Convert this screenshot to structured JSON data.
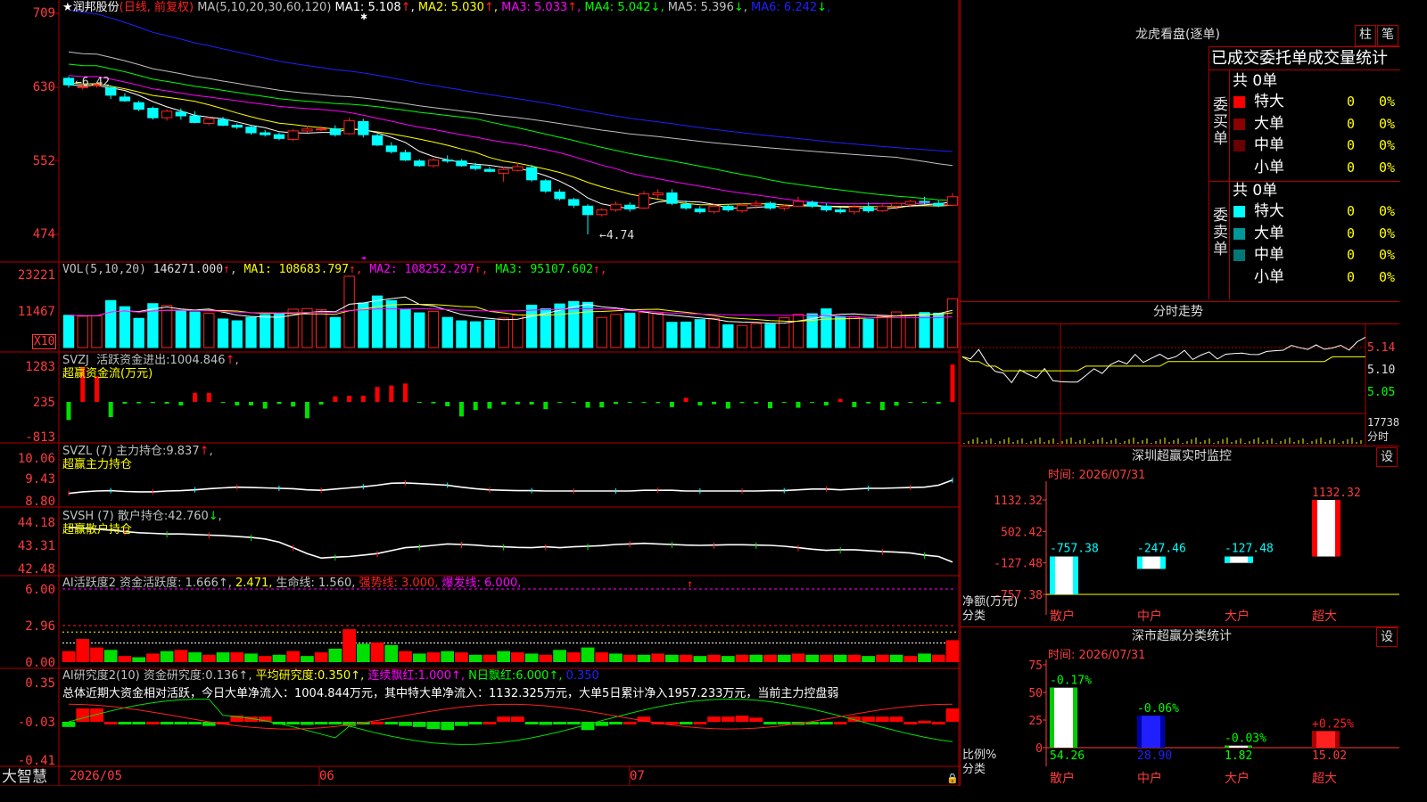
{
  "colors": {
    "up": "#ff2020",
    "down": "#00ffff",
    "ma1": "#ffffff",
    "ma2": "#ffff00",
    "ma3": "#ff00ff",
    "ma4": "#00ff00",
    "ma5": "#c0c0c0",
    "ma6": "#2020ff",
    "grid": "#b00000",
    "axis": "#ff3c3c",
    "green": "#00e000"
  },
  "chart": {
    "stock_name": "★润邦股份",
    "period_tag": "(日线, 前复权)",
    "ma_params": "MA(5,10,20,30,60,120)",
    "ma_values": [
      {
        "label": "MA1:",
        "value": "5.108",
        "arrow": "↑",
        "color": "#ffffff"
      },
      {
        "label": "MA2:",
        "value": "5.030",
        "arrow": "↑",
        "color": "#ffff00"
      },
      {
        "label": "MA3:",
        "value": "5.033",
        "arrow": "↑",
        "color": "#ff00ff"
      },
      {
        "label": "MA4:",
        "value": "5.042",
        "arrow": "↓",
        "color": "#00ff00"
      },
      {
        "label": "MA5:",
        "value": "5.396",
        "arrow": "↓",
        "color": "#c0c0c0"
      },
      {
        "label": "MA6:",
        "value": "6.242",
        "arrow": "↓",
        "color": "#2020ff"
      }
    ],
    "price_ticks": [
      "709",
      "630",
      "552",
      "474"
    ],
    "high_label": "6.42",
    "low_label": "4.74",
    "vol_title": "VOL(5,10,20)",
    "vol_value": "146271.000",
    "vol_ma": [
      {
        "label": "MA1:",
        "value": "108683.797",
        "color": "#ffff00"
      },
      {
        "label": "MA2:",
        "value": "108252.297",
        "color": "#ff00ff"
      },
      {
        "label": "MA3:",
        "value": "95107.602",
        "color": "#00ff00"
      }
    ],
    "vol_ticks": [
      "23221",
      "11467"
    ],
    "vol_unit": "X10",
    "svzj_title": "SVZJ",
    "svzj_label": "活跃资金进出:",
    "svzj_value": "1004.846",
    "svzj_sub": "超赢资金流(万元)",
    "svzj_ticks": [
      "1283",
      "235",
      "-813"
    ],
    "svzl_title": "SVZL (7)",
    "svzl_label": "主力持仓:",
    "svzl_value": "9.837",
    "svzl_sub": "超赢主力持仓",
    "svzl_ticks": [
      "10.06",
      "9.43",
      "8.80"
    ],
    "svsh_title": "SVSH (7)",
    "svsh_label": "散户持仓:",
    "svsh_value": "42.760",
    "svsh_sub": "超赢散户持仓",
    "svsh_ticks": [
      "44.18",
      "43.31",
      "42.48"
    ],
    "ai1_title": "AI活跃度2",
    "ai1_items": [
      {
        "text": "资金活跃度:",
        "color": "#c0c0c0"
      },
      {
        "text": "1.666",
        "color": "#c0c0c0"
      },
      {
        "text": "2.471,",
        "color": "#ffff00"
      },
      {
        "text": "生命线:",
        "color": "#c0c0c0"
      },
      {
        "text": "1.560,",
        "color": "#c0c0c0"
      },
      {
        "text": "强势线:",
        "color": "#ff2020"
      },
      {
        "text": "3.000,",
        "color": "#ff2020"
      },
      {
        "text": "爆发线:",
        "color": "#ff00ff"
      },
      {
        "text": "6.000,",
        "color": "#ff00ff"
      }
    ],
    "ai1_ticks": [
      "6.00",
      "2.96",
      "0.00"
    ],
    "ai2_title": "AI研究度2(10)",
    "ai2_items": [
      {
        "text": "资金研究度:",
        "color": "#c0c0c0"
      },
      {
        "text": "0.136",
        "color": "#c0c0c0"
      },
      {
        "text": "平均研究度:",
        "color": "#ffff00"
      },
      {
        "text": "0.350",
        "color": "#ffff00"
      },
      {
        "text": "连续飘红:",
        "color": "#ff00ff"
      },
      {
        "text": "1.000",
        "color": "#ff00ff"
      },
      {
        "text": "N日飘红:",
        "color": "#00ff00"
      },
      {
        "text": "6.000",
        "color": "#00ff00"
      },
      {
        "text": "0.350",
        "color": "#2020ff"
      }
    ],
    "ai2_ticks": [
      "0.35",
      "-0.03",
      "-0.41"
    ],
    "summary": "总体近期大资金相对活跃，今日大单净流入：1004.844万元，其中特大单净流入：1132.325万元，大单5日累计净入1957.233万元，当前主力控盘弱",
    "date_ticks": [
      "2026/05",
      "06",
      "07"
    ],
    "logo": "大智慧"
  },
  "right": {
    "lhb_title": "龙虎看盘(逐单)",
    "btn1": "柱",
    "btn2": "笔",
    "stat_title": "已成交委托单成交量统计",
    "buy_side": "委买单",
    "sell_side": "委卖单",
    "buy_total": "共 0单",
    "sell_total": "共 0单",
    "buy_rows": [
      {
        "name": "特大",
        "count": "0",
        "pct": "0%",
        "color": "#ff0000"
      },
      {
        "name": "大单",
        "count": "0",
        "pct": "0%",
        "color": "#8b0000"
      },
      {
        "name": "中单",
        "count": "0",
        "pct": "0%",
        "color": "#6b0000"
      },
      {
        "name": "小单",
        "count": "0",
        "pct": "0%",
        "color": "#000000"
      }
    ],
    "sell_rows": [
      {
        "name": "特大",
        "count": "0",
        "pct": "0%",
        "color": "#00ffff"
      },
      {
        "name": "大单",
        "count": "0",
        "pct": "0%",
        "color": "#009999"
      },
      {
        "name": "中单",
        "count": "0",
        "pct": "0%",
        "color": "#007777"
      },
      {
        "name": "小单",
        "count": "0",
        "pct": "0%",
        "color": "#000000"
      }
    ],
    "fs_title": "分时走势",
    "fs_ticks": [
      "5.14",
      "5.10",
      "5.05"
    ],
    "fs_vol": "17738",
    "fs_vol_unit": "分时",
    "sz_title": "深圳超赢实时监控",
    "sz_btn": "设",
    "sz_time": "时间: 2026/07/31",
    "sz_ticks": [
      "1132.32",
      "502.42",
      "-127.48",
      "-757.38"
    ],
    "sz_ylabel1": "净额(万元)",
    "sz_ylabel2": "分类",
    "sz_bars": [
      {
        "cat": "散户",
        "value": "-757.38",
        "num": -757.38
      },
      {
        "cat": "中户",
        "value": "-247.46",
        "num": -247.46
      },
      {
        "cat": "大户",
        "value": "-127.48",
        "num": -127.48
      },
      {
        "cat": "超大",
        "value": "1132.32",
        "num": 1132.32
      }
    ],
    "fl_title": "深市超赢分类统计",
    "fl_btn": "设",
    "fl_time": "时间: 2026/07/31",
    "fl_ticks": [
      "75",
      "50",
      "25",
      "0"
    ],
    "fl_ylabel1": "比例%",
    "fl_ylabel2": "分类",
    "fl_bars": [
      {
        "cat": "散户",
        "value": "54.26",
        "num": 54.26,
        "change": "-0.17%",
        "change_color": "#00ff00",
        "color": "#ffffff"
      },
      {
        "cat": "中户",
        "value": "28.90",
        "num": 28.9,
        "change": "-0.06%",
        "change_color": "#00ff00",
        "color": "#2020ff"
      },
      {
        "cat": "大户",
        "value": "1.82",
        "num": 1.82,
        "change": "-0.03%",
        "change_color": "#00ff00",
        "color": "#ffffff"
      },
      {
        "cat": "超大",
        "value": "15.02",
        "num": 15.02,
        "change": "+0.25%",
        "change_color": "#ff2020",
        "color": "#ff2020"
      }
    ]
  },
  "chart_data": {
    "type": "candlestick",
    "dates_label": [
      "2026/05",
      "06",
      "07"
    ],
    "ohlc": [
      [
        6.4,
        6.42,
        6.3,
        6.33
      ],
      [
        6.3,
        6.34,
        6.28,
        6.31
      ],
      [
        6.32,
        6.35,
        6.3,
        6.33
      ],
      [
        6.3,
        6.31,
        6.18,
        6.22
      ],
      [
        6.2,
        6.24,
        6.15,
        6.16
      ],
      [
        6.14,
        6.16,
        6.05,
        6.07
      ],
      [
        6.08,
        6.1,
        5.96,
        5.98
      ],
      [
        5.98,
        6.07,
        5.95,
        6.05
      ],
      [
        6.04,
        6.08,
        5.96,
        6.0
      ],
      [
        6.0,
        6.05,
        5.92,
        5.93
      ],
      [
        5.92,
        5.99,
        5.9,
        5.97
      ],
      [
        5.96,
        5.99,
        5.89,
        5.9
      ],
      [
        5.9,
        5.92,
        5.86,
        5.88
      ],
      [
        5.88,
        5.9,
        5.8,
        5.82
      ],
      [
        5.82,
        5.85,
        5.78,
        5.8
      ],
      [
        5.8,
        5.82,
        5.74,
        5.76
      ],
      [
        5.75,
        5.86,
        5.73,
        5.84
      ],
      [
        5.84,
        5.89,
        5.82,
        5.86
      ],
      [
        5.86,
        5.89,
        5.84,
        5.86
      ],
      [
        5.86,
        5.9,
        5.78,
        5.8
      ],
      [
        5.81,
        5.98,
        5.8,
        5.95
      ],
      [
        5.94,
        5.97,
        5.77,
        5.8
      ],
      [
        5.79,
        5.81,
        5.68,
        5.69
      ],
      [
        5.68,
        5.72,
        5.6,
        5.62
      ],
      [
        5.61,
        5.64,
        5.52,
        5.53
      ],
      [
        5.52,
        5.54,
        5.46,
        5.47
      ],
      [
        5.47,
        5.55,
        5.45,
        5.53
      ],
      [
        5.53,
        5.58,
        5.5,
        5.52
      ],
      [
        5.52,
        5.54,
        5.46,
        5.47
      ],
      [
        5.47,
        5.5,
        5.42,
        5.44
      ],
      [
        5.43,
        5.46,
        5.4,
        5.41
      ],
      [
        5.39,
        5.46,
        5.3,
        5.43
      ],
      [
        5.42,
        5.5,
        5.41,
        5.46
      ],
      [
        5.45,
        5.48,
        5.3,
        5.32
      ],
      [
        5.31,
        5.33,
        5.18,
        5.2
      ],
      [
        5.19,
        5.22,
        5.1,
        5.12
      ],
      [
        5.11,
        5.13,
        5.02,
        5.05
      ],
      [
        5.04,
        5.06,
        4.74,
        4.95
      ],
      [
        4.95,
        5.02,
        4.93,
        5.0
      ],
      [
        5.0,
        5.09,
        4.98,
        5.06
      ],
      [
        5.05,
        5.08,
        4.98,
        5.01
      ],
      [
        5.02,
        5.2,
        5.01,
        5.17
      ],
      [
        5.16,
        5.22,
        5.12,
        5.18
      ],
      [
        5.18,
        5.22,
        5.05,
        5.07
      ],
      [
        5.06,
        5.1,
        5.0,
        5.02
      ],
      [
        5.01,
        5.04,
        4.96,
        4.98
      ],
      [
        4.98,
        5.07,
        4.96,
        5.04
      ],
      [
        5.04,
        5.06,
        4.98,
        5.0
      ],
      [
        4.99,
        5.07,
        4.97,
        5.05
      ],
      [
        5.05,
        5.1,
        5.01,
        5.07
      ],
      [
        5.07,
        5.09,
        5.0,
        5.02
      ],
      [
        5.02,
        5.06,
        4.99,
        5.04
      ],
      [
        5.04,
        5.14,
        5.03,
        5.09
      ],
      [
        5.08,
        5.1,
        5.02,
        5.04
      ],
      [
        5.04,
        5.07,
        4.98,
        5.0
      ],
      [
        5.0,
        5.03,
        4.96,
        4.98
      ],
      [
        4.98,
        5.05,
        4.95,
        5.03
      ],
      [
        5.03,
        5.08,
        4.97,
        4.99
      ],
      [
        4.99,
        5.06,
        4.98,
        5.04
      ],
      [
        5.04,
        5.08,
        5.0,
        5.07
      ],
      [
        5.06,
        5.11,
        5.04,
        5.09
      ],
      [
        5.09,
        5.14,
        5.06,
        5.08
      ],
      [
        5.07,
        5.1,
        5.03,
        5.05
      ],
      [
        5.05,
        5.18,
        5.04,
        5.14
      ]
    ],
    "volume": [
      10500,
      10200,
      10300,
      15300,
      13300,
      9500,
      14300,
      13700,
      12000,
      11600,
      11200,
      9300,
      8700,
      9800,
      10700,
      10900,
      12500,
      12700,
      12300,
      9800,
      23221,
      14500,
      16800,
      15300,
      12400,
      11300,
      11800,
      9800,
      8700,
      8400,
      8900,
      9600,
      10600,
      13800,
      12600,
      14200,
      15000,
      14700,
      9800,
      10800,
      11200,
      11500,
      11200,
      8200,
      8300,
      9100,
      9500,
      7400,
      7200,
      7800,
      7600,
      9700,
      10800,
      11000,
      12600,
      10200,
      10100,
      9200,
      10300,
      11600,
      10600,
      11400,
      11200,
      15900
    ],
    "svzj": [
      -620,
      1200,
      880,
      -520,
      -60,
      -50,
      -40,
      -60,
      -120,
      310,
      310,
      -10,
      -120,
      -120,
      -230,
      -70,
      -160,
      -560,
      -90,
      190,
      210,
      210,
      510,
      560,
      630,
      -20,
      -50,
      -150,
      -500,
      -280,
      -230,
      -90,
      -80,
      -90,
      -250,
      -20,
      -10,
      -200,
      -190,
      -70,
      -20,
      -10,
      -40,
      -180,
      140,
      -120,
      -80,
      -230,
      -40,
      -50,
      -220,
      -20,
      -200,
      -30,
      -120,
      100,
      -180,
      -50,
      -280,
      -130,
      -30,
      -20,
      -60,
      1283
    ],
    "svzl": [
      9.06,
      9.1,
      9.12,
      9.13,
      9.11,
      9.1,
      9.1,
      9.12,
      9.13,
      9.15,
      9.18,
      9.2,
      9.22,
      9.21,
      9.2,
      9.19,
      9.18,
      9.15,
      9.14,
      9.17,
      9.2,
      9.23,
      9.27,
      9.32,
      9.33,
      9.31,
      9.29,
      9.27,
      9.22,
      9.18,
      9.15,
      9.14,
      9.13,
      9.13,
      9.12,
      9.12,
      9.12,
      9.12,
      9.12,
      9.12,
      9.12,
      9.14,
      9.14,
      9.14,
      9.12,
      9.12,
      9.12,
      9.12,
      9.12,
      9.12,
      9.13,
      9.13,
      9.15,
      9.17,
      9.17,
      9.15,
      9.17,
      9.19,
      9.19,
      9.2,
      9.21,
      9.22,
      9.27,
      9.4
    ],
    "svsh": [
      43.95,
      43.92,
      43.88,
      43.85,
      43.8,
      43.76,
      43.74,
      43.72,
      43.72,
      43.7,
      43.68,
      43.66,
      43.63,
      43.6,
      43.55,
      43.44,
      43.25,
      43.05,
      42.9,
      42.93,
      42.95,
      43.0,
      43.05,
      43.15,
      43.25,
      43.28,
      43.33,
      43.38,
      43.36,
      43.34,
      43.3,
      43.28,
      43.26,
      43.25,
      43.28,
      43.25,
      43.28,
      43.3,
      43.32,
      43.36,
      43.38,
      43.4,
      43.38,
      43.36,
      43.34,
      43.33,
      43.34,
      43.35,
      43.35,
      43.34,
      43.33,
      43.3,
      43.25,
      43.2,
      43.16,
      43.18,
      43.18,
      43.15,
      43.12,
      43.1,
      43.07,
      43.0,
      42.95,
      42.76
    ],
    "ai1": [
      0.9,
      1.9,
      1.2,
      1.0,
      0.5,
      0.4,
      0.7,
      0.9,
      1.0,
      0.8,
      0.6,
      0.8,
      0.8,
      0.7,
      0.5,
      0.6,
      0.9,
      0.5,
      0.8,
      1.1,
      2.7,
      1.5,
      1.6,
      1.4,
      0.9,
      0.7,
      0.8,
      0.9,
      0.8,
      0.6,
      0.6,
      0.9,
      0.8,
      0.7,
      0.6,
      1.0,
      0.8,
      1.2,
      0.8,
      0.7,
      0.6,
      0.6,
      0.7,
      0.6,
      0.6,
      0.5,
      0.6,
      0.5,
      0.6,
      0.6,
      0.6,
      0.6,
      0.7,
      0.6,
      0.6,
      0.6,
      0.6,
      0.5,
      0.6,
      0.6,
      0.5,
      0.7,
      0.6,
      1.8
    ],
    "ai2": [
      -0.08,
      0.1,
      0.1,
      -0.03,
      -0.05,
      -0.05,
      -0.03,
      -0.04,
      -0.05,
      -0.05,
      -0.07,
      -0.03,
      0.03,
      0.02,
      0.02,
      -0.05,
      -0.05,
      -0.06,
      -0.05,
      -0.05,
      -0.07,
      -0.05,
      -0.03,
      -0.05,
      -0.07,
      -0.08,
      -0.1,
      -0.11,
      -0.07,
      -0.05,
      -0.03,
      0.02,
      0.02,
      -0.05,
      -0.06,
      -0.05,
      -0.05,
      -0.11,
      -0.07,
      -0.05,
      -0.03,
      0.02,
      -0.03,
      -0.03,
      -0.05,
      -0.03,
      0.02,
      0.02,
      0.03,
      0.01,
      -0.05,
      -0.05,
      -0.06,
      -0.05,
      -0.04,
      -0.03,
      0.02,
      0.02,
      0.02,
      0.02,
      -0.03,
      -0.02,
      -0.03,
      0.1
    ],
    "fenshi": [
      5.12,
      5.12,
      5.13,
      5.11,
      5.09,
      5.08,
      5.07,
      5.09,
      5.08,
      5.08,
      5.09,
      5.07,
      5.07,
      5.06,
      5.07,
      5.08,
      5.09,
      5.09,
      5.1,
      5.11,
      5.11,
      5.12,
      5.11,
      5.12,
      5.12,
      5.12,
      5.12,
      5.13,
      5.12,
      5.12,
      5.13,
      5.12,
      5.12,
      5.13,
      5.13,
      5.12,
      5.13,
      5.13,
      5.13,
      5.14,
      5.14,
      5.14,
      5.14,
      5.14,
      5.14,
      5.14,
      5.14,
      5.14,
      5.15,
      5.16
    ],
    "fenshi_avg": [
      5.12,
      5.11,
      5.11,
      5.1,
      5.1,
      5.09,
      5.09,
      5.09,
      5.09,
      5.09,
      5.09,
      5.09,
      5.09,
      5.09,
      5.09,
      5.1,
      5.1,
      5.1,
      5.1,
      5.1,
      5.1,
      5.1,
      5.1,
      5.1,
      5.1,
      5.11,
      5.11,
      5.11,
      5.11,
      5.11,
      5.11,
      5.11,
      5.11,
      5.11,
      5.11,
      5.11,
      5.11,
      5.11,
      5.11,
      5.11,
      5.11,
      5.11,
      5.11,
      5.11,
      5.11,
      5.12,
      5.12,
      5.12,
      5.12,
      5.12
    ]
  }
}
